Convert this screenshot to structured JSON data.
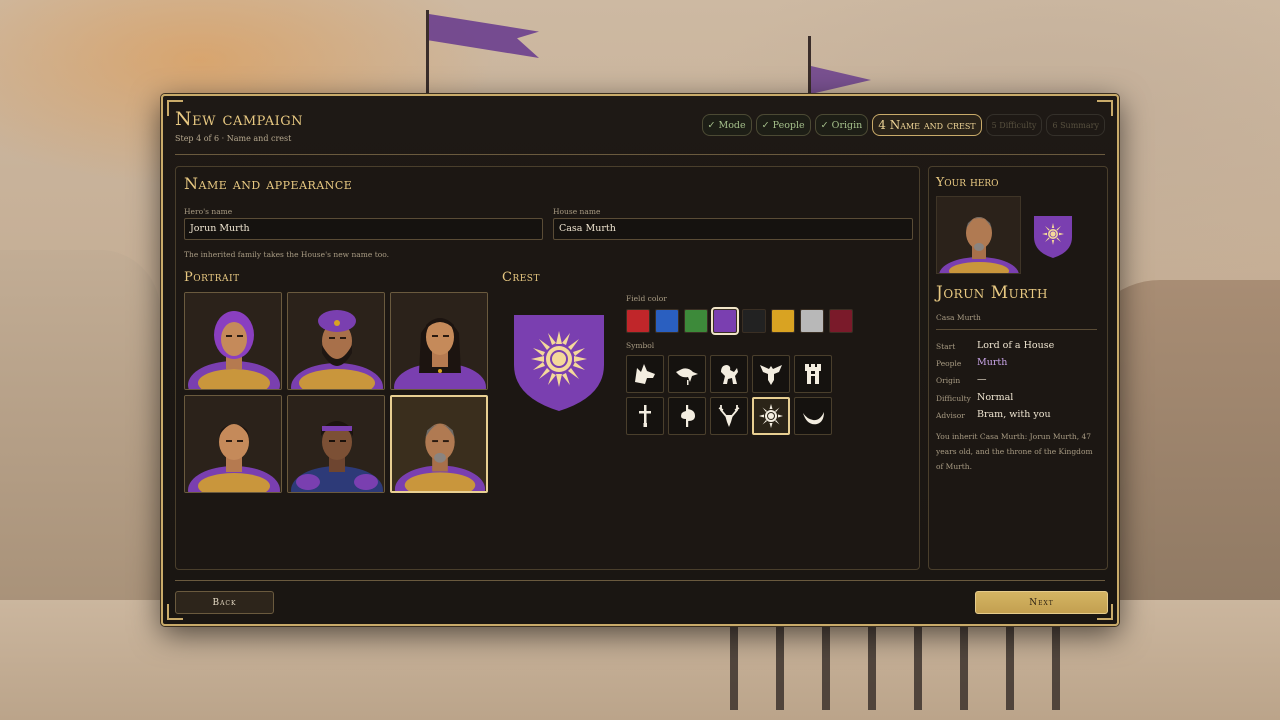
{
  "header": {
    "title": "New campaign",
    "subtitle": "Step 4 of 6 · Name and crest"
  },
  "steps": [
    {
      "label": "✓ Mode",
      "state": "done"
    },
    {
      "label": "✓ People",
      "state": "done"
    },
    {
      "label": "✓ Origin",
      "state": "done"
    },
    {
      "label": "4 Name and crest",
      "state": "active"
    },
    {
      "label": "5 Difficulty",
      "state": "todo"
    },
    {
      "label": "6 Summary",
      "state": "todo"
    }
  ],
  "main": {
    "heading": "Name and appearance",
    "hero_name_label": "Hero's name",
    "hero_name_value": "Jorun Murth",
    "house_name_label": "House name",
    "house_name_value": "Casa Murth",
    "note": "The inherited family takes the House's new name too.",
    "portrait_heading": "Portrait",
    "crest_heading": "Crest",
    "field_color_label": "Field color",
    "symbol_label": "Symbol",
    "field_colors": [
      "#c0262a",
      "#2a5fc0",
      "#3d8a3a",
      "#7a3fb0",
      "#222222",
      "#d9a322",
      "#b8b8b8",
      "#7a1a2a"
    ],
    "selected_field_color": "#7a3fb0",
    "symbols": [
      "wolf-icon",
      "raven-icon",
      "lion-icon",
      "eagle-icon",
      "tower-icon",
      "sword-icon",
      "axe-icon",
      "stag-icon",
      "sun-icon",
      "moon-icon"
    ],
    "selected_symbol": "sun-icon",
    "selected_portrait": 6
  },
  "side": {
    "title": "Your hero",
    "hero_name": "Jorun Murth",
    "house": "Casa Murth",
    "rows": [
      {
        "label": "Start",
        "value": "Lord of a House"
      },
      {
        "label": "People",
        "value": "Murth"
      },
      {
        "label": "Origin",
        "value": "—"
      },
      {
        "label": "Difficulty",
        "value": "Normal"
      },
      {
        "label": "Advisor",
        "value": "Bram, with you"
      }
    ],
    "summary": "You inherit Casa Murth: Jorun Murth, 47 years old, and the throne of the Kingdom of Murth."
  },
  "footer": {
    "back_label": "Back",
    "next_label": "Next"
  }
}
